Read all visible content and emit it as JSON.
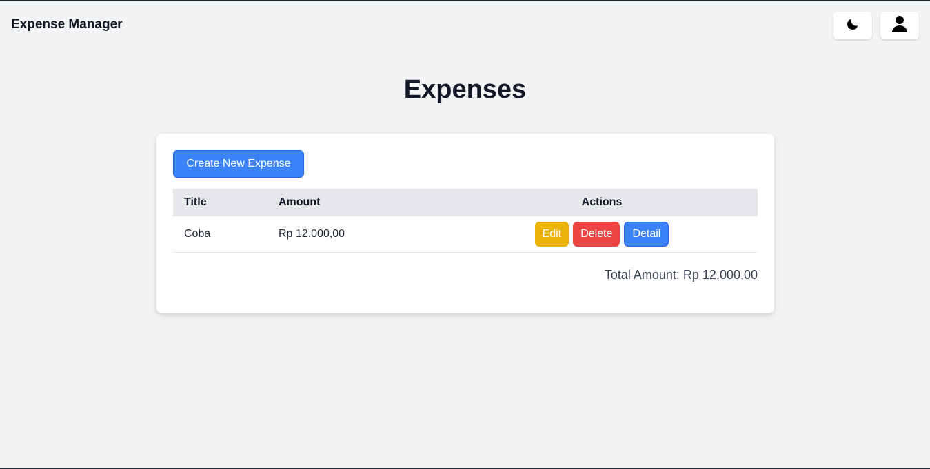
{
  "app": {
    "brand": "Expense Manager"
  },
  "nav": {
    "theme_icon": "moon-icon",
    "user_icon": "user-icon"
  },
  "page": {
    "title": "Expenses"
  },
  "toolbar": {
    "create_label": "Create New Expense"
  },
  "table": {
    "headers": {
      "title": "Title",
      "amount": "Amount",
      "actions": "Actions"
    },
    "rows": [
      {
        "title": "Coba",
        "amount": "Rp 12.000,00",
        "actions": {
          "edit": "Edit",
          "delete": "Delete",
          "detail": "Detail"
        }
      }
    ]
  },
  "summary": {
    "total": "Total Amount: Rp 12.000,00"
  },
  "colors": {
    "primary": "#3b82f6",
    "warning": "#eab308",
    "danger": "#ef4444",
    "background": "#f3f4f6",
    "table_header": "#e5e7eb"
  }
}
